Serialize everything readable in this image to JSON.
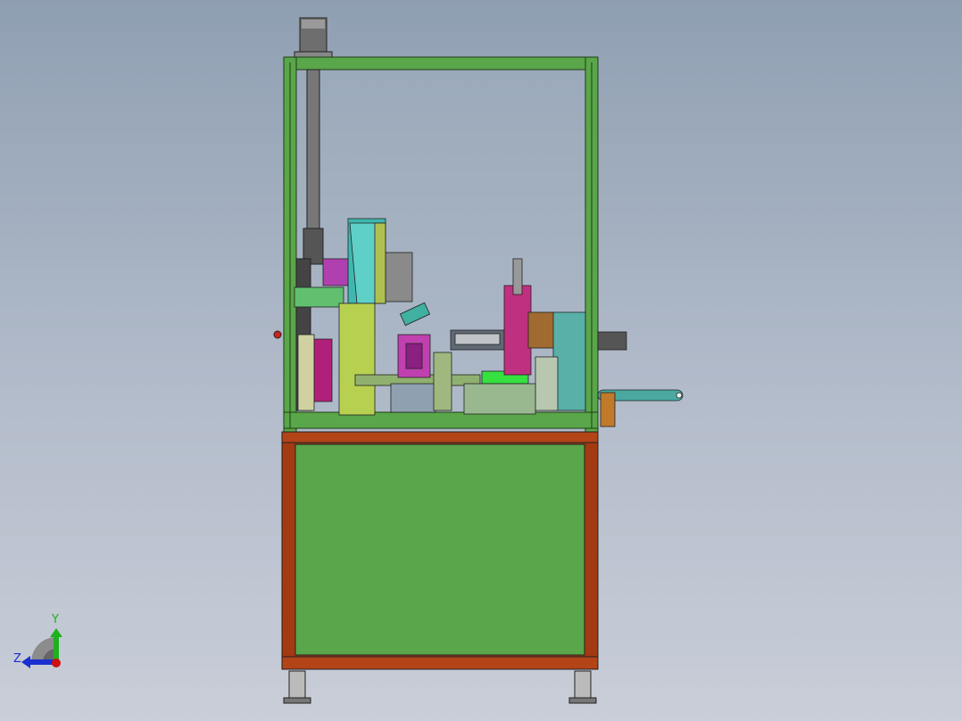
{
  "viewport": {
    "background_top": "#8f9fb2",
    "background_bottom": "#c9ced8"
  },
  "model": {
    "frame_color": "#5aa64a",
    "base_frame_color": "#a33a12",
    "panel_color": "#5aa64a"
  },
  "triad": {
    "y_label": "Y",
    "z_label": "Z",
    "y_color": "#1fb01f",
    "z_color": "#1a2fd0",
    "x_color": "#d01010"
  }
}
